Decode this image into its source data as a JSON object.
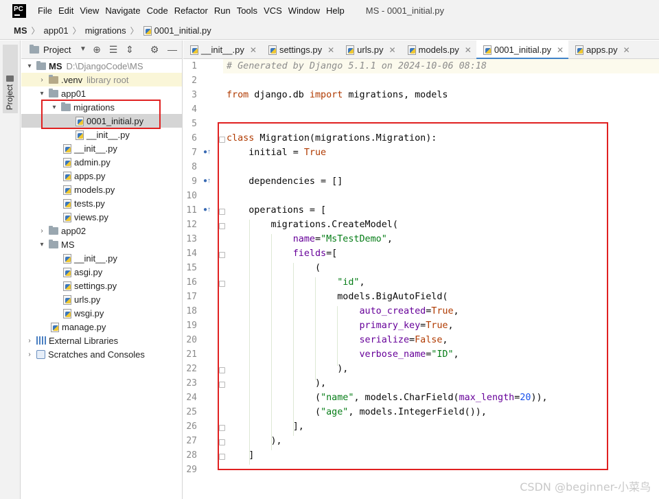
{
  "menu": {
    "items": [
      "File",
      "Edit",
      "View",
      "Navigate",
      "Code",
      "Refactor",
      "Run",
      "Tools",
      "VCS",
      "Window",
      "Help"
    ],
    "window_title": "MS - 0001_initial.py"
  },
  "breadcrumb": {
    "items": [
      "MS",
      "app01",
      "migrations",
      "0001_initial.py"
    ]
  },
  "tool_stripe": {
    "project_tab": "Project"
  },
  "project_panel": {
    "title": "Project",
    "tree": [
      {
        "label": "MS",
        "hint": "D:\\DjangoCode\\MS"
      },
      {
        "label": ".venv",
        "hint": "library root"
      },
      {
        "label": "app01"
      },
      {
        "label": "migrations"
      },
      {
        "label": "0001_initial.py"
      },
      {
        "label": "__init__.py"
      },
      {
        "label": "__init__.py"
      },
      {
        "label": "admin.py"
      },
      {
        "label": "apps.py"
      },
      {
        "label": "models.py"
      },
      {
        "label": "tests.py"
      },
      {
        "label": "views.py"
      },
      {
        "label": "app02"
      },
      {
        "label": "MS"
      },
      {
        "label": "__init__.py"
      },
      {
        "label": "asgi.py"
      },
      {
        "label": "settings.py"
      },
      {
        "label": "urls.py"
      },
      {
        "label": "wsgi.py"
      },
      {
        "label": "manage.py"
      },
      {
        "label": "External Libraries"
      },
      {
        "label": "Scratches and Consoles"
      }
    ]
  },
  "tabs": [
    {
      "label": "__init__.py"
    },
    {
      "label": "settings.py"
    },
    {
      "label": "urls.py"
    },
    {
      "label": "models.py"
    },
    {
      "label": "0001_initial.py"
    },
    {
      "label": "apps.py"
    }
  ],
  "editor": {
    "line_numbers": [
      "1",
      "2",
      "3",
      "4",
      "5",
      "6",
      "7",
      "8",
      "9",
      "10",
      "11",
      "12",
      "13",
      "14",
      "15",
      "16",
      "17",
      "18",
      "19",
      "20",
      "21",
      "22",
      "23",
      "24",
      "25",
      "26",
      "27",
      "28",
      "29"
    ],
    "code": {
      "l1": "# Generated by Django 5.1.1 on 2024-10-06 08:18",
      "l3_from": "from",
      "l3_mod": " django.db ",
      "l3_import": "import",
      "l3_rest": " migrations, models",
      "l6_class": "class",
      "l6_rest": " Migration(migrations.Migration):",
      "l7_a": "    initial = ",
      "l7_b": "True",
      "l9": "    dependencies = []",
      "l11": "    operations = [",
      "l12": "        migrations.CreateModel(",
      "l13_a": "            ",
      "l13_p": "name",
      "l13_eq": "=",
      "l13_s": "\"MsTestDemo\"",
      "l13_c": ",",
      "l14_a": "            ",
      "l14_p": "fields",
      "l14_b": "=[",
      "l15": "                (",
      "l16_a": "                    ",
      "l16_s": "\"id\"",
      "l16_c": ",",
      "l17": "                    models.BigAutoField(",
      "l18_a": "                        ",
      "l18_p": "auto_created",
      "l18_eq": "=",
      "l18_v": "True",
      "l18_c": ",",
      "l19_a": "                        ",
      "l19_p": "primary_key",
      "l19_eq": "=",
      "l19_v": "True",
      "l19_c": ",",
      "l20_a": "                        ",
      "l20_p": "serialize",
      "l20_eq": "=",
      "l20_v": "False",
      "l20_c": ",",
      "l21_a": "                        ",
      "l21_p": "verbose_name",
      "l21_eq": "=",
      "l21_s": "\"ID\"",
      "l21_c": ",",
      "l22": "                    ),",
      "l23": "                ),",
      "l24_a": "                (",
      "l24_s": "\"name\"",
      "l24_b": ", models.CharField(",
      "l24_p": "max_length",
      "l24_eq": "=",
      "l24_n": "20",
      "l24_c": ")),",
      "l25_a": "                (",
      "l25_s": "\"age\"",
      "l25_b": ", models.IntegerField()),",
      "l26": "            ],",
      "l27": "        ),",
      "l28": "    ]"
    }
  },
  "watermark": "CSDN @beginner-小菜鸟",
  "colors": {
    "annotation_red": "#e02020",
    "active_tab_accent": "#4083c9",
    "keyword": "#b03a00",
    "string": "#067d17",
    "param": "#660099",
    "number": "#1750eb",
    "comment": "#8c8c8c"
  }
}
